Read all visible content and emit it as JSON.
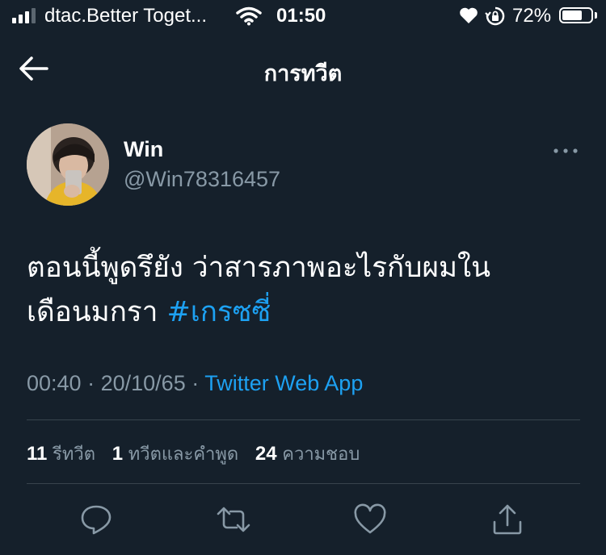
{
  "status_bar": {
    "carrier": "dtac.Better Toget...",
    "time": "01:50",
    "battery_percent": "72%",
    "battery_level": 0.72,
    "signal_bars_active": 3
  },
  "header": {
    "title": "การทวีต",
    "back_icon": "arrow-left-icon"
  },
  "tweet": {
    "display_name": "Win",
    "handle": "@Win78316457",
    "text_line1": "ตอนนี้พูดรึยัง ว่าสารภาพอะไรกับผมใน",
    "text_line2_prefix": "เดือนมกรา ",
    "hashtag": "#เกรซซี่",
    "time": "00:40",
    "date": "20/10/65",
    "separator": "·",
    "source": "Twitter Web App"
  },
  "stats": {
    "retweets_count": "11",
    "retweets_label": "รีทวีต",
    "quotes_count": "1",
    "quotes_label": "ทวีตและคำพูด",
    "likes_count": "24",
    "likes_label": "ความชอบ"
  },
  "actions": [
    "reply-icon",
    "retweet-icon",
    "like-icon",
    "share-icon"
  ],
  "colors": {
    "background": "#15202b",
    "text": "#ffffff",
    "secondary": "#8899a6",
    "accent": "#1da1f2",
    "divider": "#38444d"
  }
}
